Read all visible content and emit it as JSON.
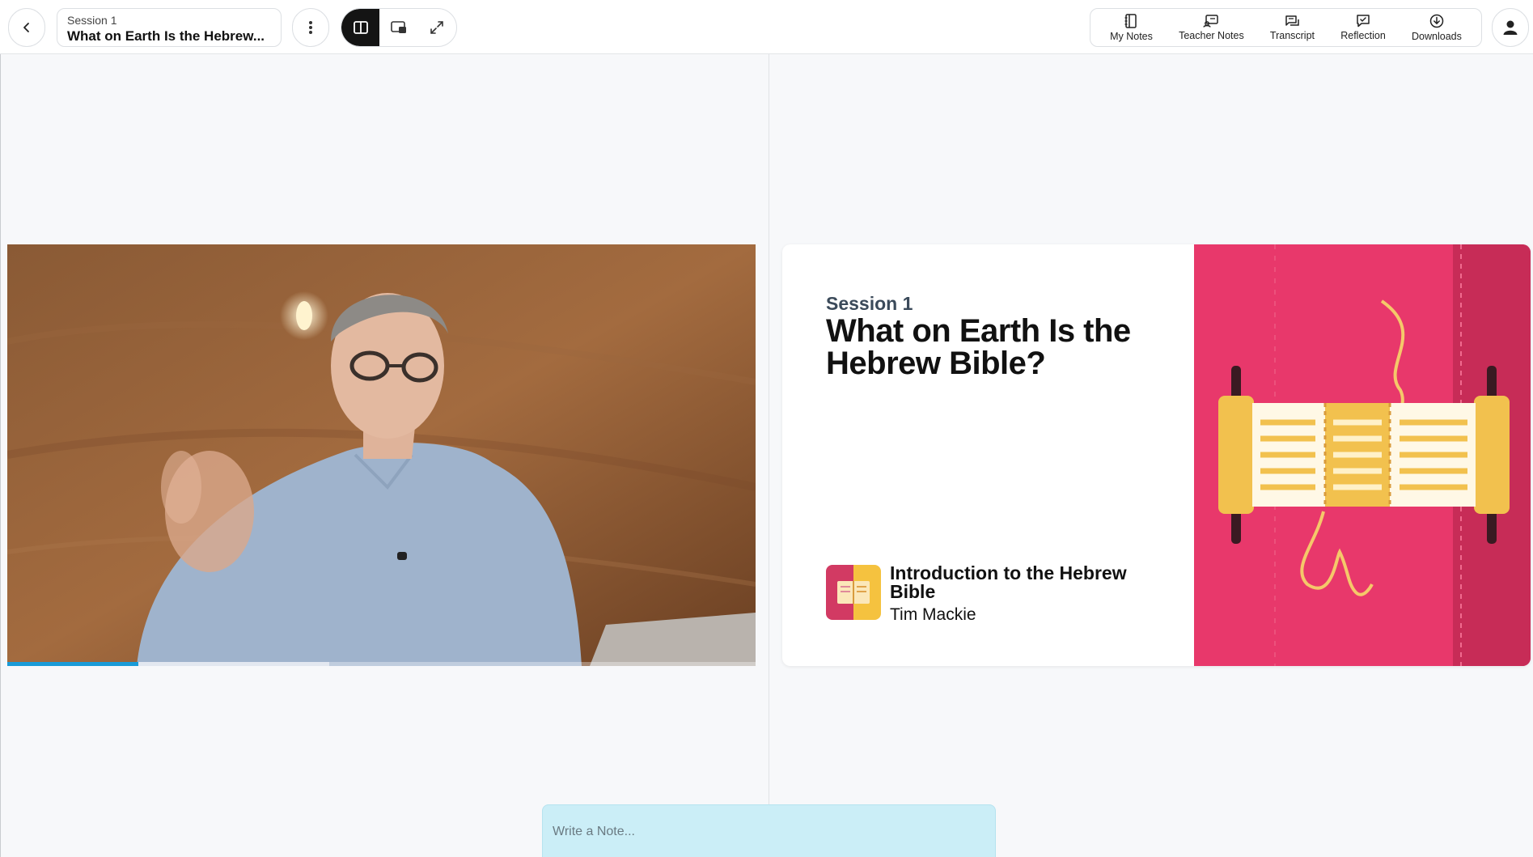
{
  "header": {
    "session_label": "Session 1",
    "session_title": "What on Earth Is the Hebrew...",
    "tools": [
      {
        "label": "My Notes",
        "icon": "notebook-icon"
      },
      {
        "label": "Teacher Notes",
        "icon": "teacher-notes-icon"
      },
      {
        "label": "Transcript",
        "icon": "transcript-icon"
      },
      {
        "label": "Reflection",
        "icon": "reflection-icon"
      },
      {
        "label": "Downloads",
        "icon": "download-icon"
      }
    ],
    "view_modes": [
      "split-view",
      "picture-in-picture",
      "fullscreen"
    ],
    "active_view": "split-view"
  },
  "video": {
    "progress_fraction": 0.175,
    "buffered_fraction": 0.43
  },
  "card": {
    "session_label": "Session 1",
    "title": "What on Earth Is the Hebrew Bible?",
    "course_title": "Introduction to the Hebrew Bible",
    "author": "Tim Mackie",
    "accent_color": "#e8386b",
    "scroll_color": "#f2c14e"
  },
  "note": {
    "placeholder": "Write a Note..."
  }
}
